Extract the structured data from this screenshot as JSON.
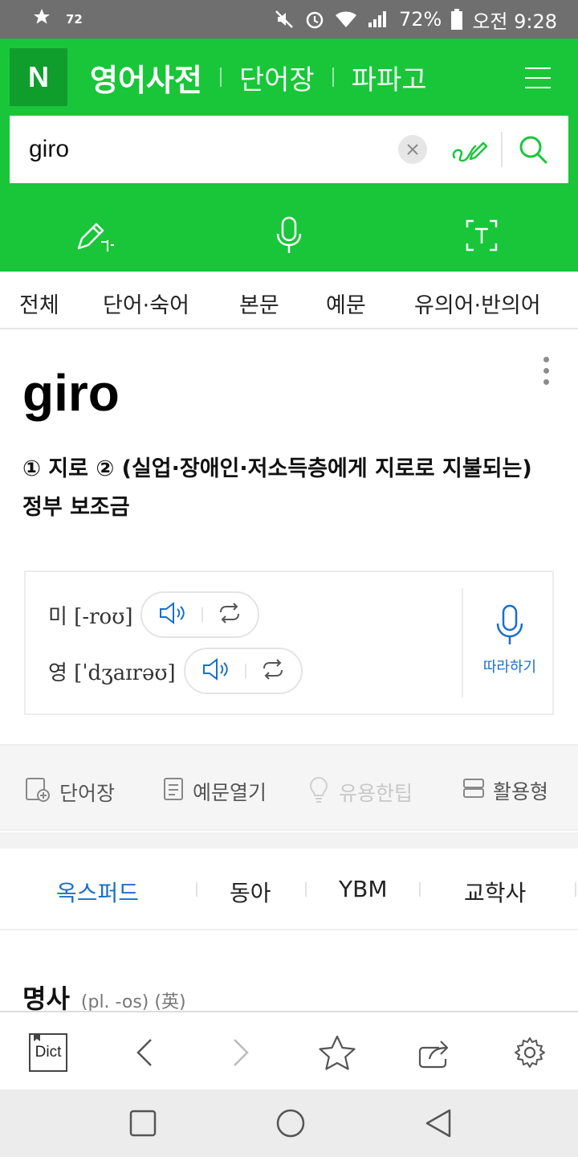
{
  "status_bar": {
    "notification_count": "72",
    "battery": "72%",
    "time": "오전 9:28"
  },
  "header": {
    "logo": "N",
    "title": "영어사전",
    "links": [
      "단어장",
      "파파고"
    ]
  },
  "search": {
    "query": "giro"
  },
  "nav_tabs": [
    "전체",
    "단어·숙어",
    "본문",
    "예문",
    "유의어·반의어"
  ],
  "entry": {
    "word": "giro",
    "meaning": "① 지로   ② (실업·장애인·저소득층에게 지로로 지불되는) 정부 보조금",
    "pronunciations": [
      {
        "label": "미 [-roʊ]"
      },
      {
        "label": "영 [ˈdʒaɪrəʊ]"
      }
    ],
    "follow_label": "따라하기"
  },
  "actions": {
    "wordbook": "단어장",
    "examples": "예문열기",
    "tips": "유용한팁",
    "forms": "활용형"
  },
  "dict_tabs": [
    "옥스퍼드",
    "동아",
    "YBM",
    "교학사"
  ],
  "active_dict_tab": "옥스퍼드",
  "pos": {
    "main": "명사",
    "sub": "(pl. -os) (英)"
  },
  "bottom_bar": {
    "dict_label": "Dict"
  },
  "colors": {
    "brand_green": "#19c63a",
    "logo_green": "#0f9e2c",
    "link_blue": "#1a6fc9"
  }
}
